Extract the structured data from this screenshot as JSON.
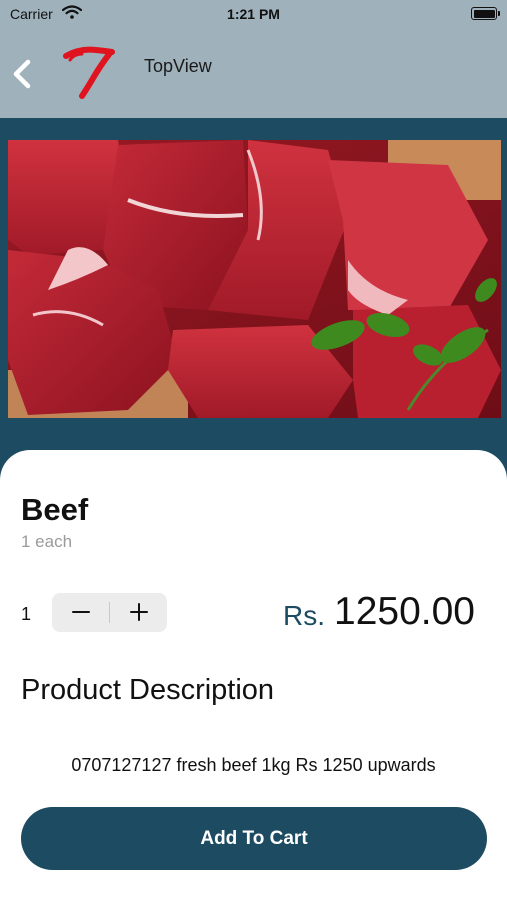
{
  "status_bar": {
    "carrier": "Carrier",
    "time": "1:21 PM"
  },
  "nav": {
    "title": "TopView",
    "back_icon": "chevron-left-icon",
    "logo_icon": "brand-logo"
  },
  "hero": {
    "image": "raw beef cubes with parsley"
  },
  "product": {
    "name": "Beef",
    "unit": "1 each",
    "quantity": "1",
    "currency": "Rs.",
    "price": "1250.00"
  },
  "description": {
    "heading": "Product Description",
    "text": "0707127127 fresh beef 1kg Rs 1250 upwards"
  },
  "actions": {
    "add_to_cart": "Add To Cart"
  },
  "colors": {
    "header_bg": "#9fb1bb",
    "primary": "#1d4b61",
    "logo_red": "#e0141e",
    "stepper_bg": "#ececec"
  }
}
